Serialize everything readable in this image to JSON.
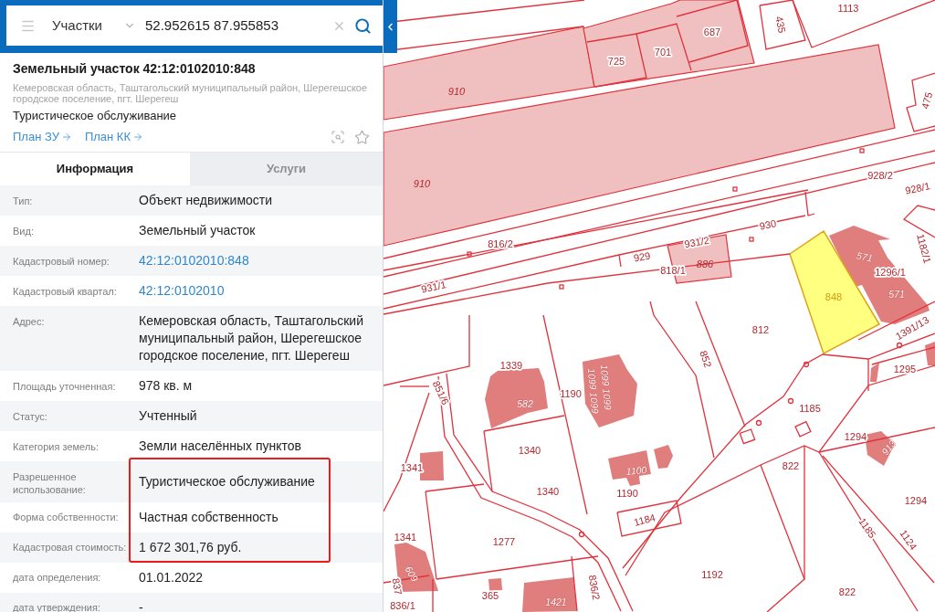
{
  "search": {
    "category": "Участки",
    "value": "52.952615 87.955853"
  },
  "object": {
    "title": "Земельный участок 42:12:0102010:848",
    "address": "Кемеровская область, Таштагольский муниципальный район, Шерегешское городское поселение, пгт. Шерегеш",
    "usage": "Туристическое обслуживание",
    "links": [
      "План ЗУ",
      "План КК"
    ]
  },
  "tabs": [
    {
      "label": "Информация",
      "selected": true
    },
    {
      "label": "Услуги",
      "selected": false
    }
  ],
  "rows": [
    {
      "label": "Тип:",
      "value": "Объект недвижимости",
      "kind": "text",
      "highlighted": false
    },
    {
      "label": "Вид:",
      "value": "Земельный участок",
      "kind": "text",
      "highlighted": false
    },
    {
      "label": "Кадастровый номер:",
      "value": "42:12:0102010:848",
      "kind": "link",
      "highlighted": false
    },
    {
      "label": "Кадастровый квартал:",
      "value": "42:12:0102010",
      "kind": "link",
      "highlighted": false
    },
    {
      "label": "Адрес:",
      "value": "Кемеровская область, Таштагольский муниципальный район, Шерегешское городское поселение, пгт. Шерегеш",
      "kind": "text",
      "highlighted": false
    },
    {
      "label": "Площадь уточненная:",
      "value": "978 кв. м",
      "kind": "text",
      "highlighted": false
    },
    {
      "label": "Статус:",
      "value": "Учтенный",
      "kind": "text",
      "highlighted": false
    },
    {
      "label": "Категория земель:",
      "value": "Земли населённых пунктов",
      "kind": "text",
      "highlighted": false
    },
    {
      "label": "Разрешенное использование:",
      "value": "Туристическое обслуживание",
      "kind": "text",
      "highlighted": true
    },
    {
      "label": "Форма собственности:",
      "value": "Частная собственность",
      "kind": "text",
      "highlighted": true
    },
    {
      "label": "Кадастровая стоимость:",
      "value": "1 672 301,76 руб.",
      "kind": "text",
      "highlighted": true
    },
    {
      "label": "дата определения:",
      "value": "01.01.2022",
      "kind": "text",
      "highlighted": false
    },
    {
      "label": "дата утверждения:",
      "value": "-",
      "kind": "text",
      "highlighted": false
    }
  ],
  "map": {
    "labels": [
      {
        "text": "1113",
        "kind": "parcel"
      },
      {
        "text": "435",
        "kind": "parcel"
      },
      {
        "text": "687",
        "kind": "parcel"
      },
      {
        "text": "701",
        "kind": "parcel"
      },
      {
        "text": "725",
        "kind": "parcel"
      },
      {
        "text": "910",
        "kind": "zone"
      },
      {
        "text": "475",
        "kind": "parcel"
      },
      {
        "text": "928/2",
        "kind": "parcel"
      },
      {
        "text": "910",
        "kind": "zone"
      },
      {
        "text": "928/1",
        "kind": "parcel"
      },
      {
        "text": "930",
        "kind": "parcel"
      },
      {
        "text": "931/2",
        "kind": "parcel"
      },
      {
        "text": "816/2",
        "kind": "parcel"
      },
      {
        "text": "1182/1",
        "kind": "parcel"
      },
      {
        "text": "929",
        "kind": "parcel"
      },
      {
        "text": "571",
        "kind": "building"
      },
      {
        "text": "886",
        "kind": "zone"
      },
      {
        "text": "818/1",
        "kind": "parcel"
      },
      {
        "text": "1296/1",
        "kind": "parcel"
      },
      {
        "text": "931/1",
        "kind": "parcel"
      },
      {
        "text": "848",
        "kind": "selected"
      },
      {
        "text": "571",
        "kind": "building"
      },
      {
        "text": "1391/13",
        "kind": "parcel"
      },
      {
        "text": "812",
        "kind": "parcel"
      },
      {
        "text": "852",
        "kind": "parcel"
      },
      {
        "text": "1339",
        "kind": "parcel"
      },
      {
        "text": "1295",
        "kind": "parcel"
      },
      {
        "text": "1099 1099",
        "kind": "building"
      },
      {
        "text": "1099 1099",
        "kind": "building"
      },
      {
        "text": "851/6",
        "kind": "parcel"
      },
      {
        "text": "1190",
        "kind": "parcel"
      },
      {
        "text": "582",
        "kind": "building"
      },
      {
        "text": "1185",
        "kind": "parcel"
      },
      {
        "text": "1294",
        "kind": "parcel"
      },
      {
        "text": "913",
        "kind": "building"
      },
      {
        "text": "1340",
        "kind": "parcel"
      },
      {
        "text": "822",
        "kind": "parcel"
      },
      {
        "text": "1341",
        "kind": "parcel"
      },
      {
        "text": "1100",
        "kind": "building"
      },
      {
        "text": "1340",
        "kind": "parcel"
      },
      {
        "text": "1190",
        "kind": "parcel"
      },
      {
        "text": "1294",
        "kind": "parcel"
      },
      {
        "text": "1184",
        "kind": "parcel"
      },
      {
        "text": "1185",
        "kind": "parcel"
      },
      {
        "text": "1341",
        "kind": "parcel"
      },
      {
        "text": "1124",
        "kind": "parcel"
      },
      {
        "text": "1277",
        "kind": "parcel"
      },
      {
        "text": "609",
        "kind": "building"
      },
      {
        "text": "1192",
        "kind": "parcel"
      },
      {
        "text": "837",
        "kind": "parcel"
      },
      {
        "text": "836/2",
        "kind": "parcel"
      },
      {
        "text": "822",
        "kind": "parcel"
      },
      {
        "text": "365",
        "kind": "parcel"
      },
      {
        "text": "1421",
        "kind": "building"
      },
      {
        "text": "836/1",
        "kind": "parcel"
      }
    ]
  }
}
